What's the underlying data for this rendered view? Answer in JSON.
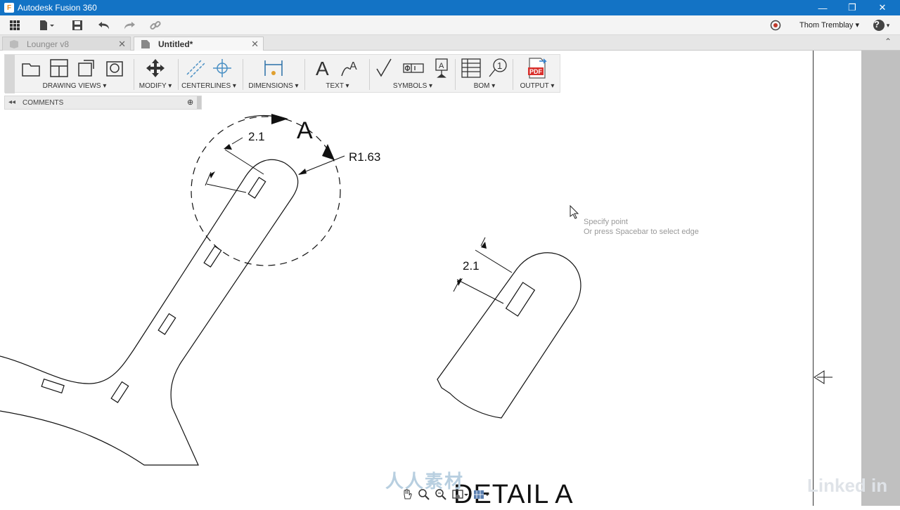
{
  "app": {
    "title": "Autodesk Fusion 360",
    "logo_letter": "F"
  },
  "window_controls": {
    "minimize": "—",
    "restore": "❐",
    "close": "✕"
  },
  "user": {
    "name": "Thom Tremblay ▾",
    "help": "?"
  },
  "tabs": [
    {
      "label": "Lounger v8",
      "close": "✕"
    },
    {
      "label": "Untitled*",
      "close": "✕"
    }
  ],
  "toolbar": {
    "groups": [
      "DRAWING VIEWS ▾",
      "MODIFY ▾",
      "CENTERLINES ▾",
      "DIMENSIONS ▾",
      "TEXT ▾",
      "SYMBOLS ▾",
      "BOM ▾",
      "OUTPUT ▾"
    ],
    "pdf_label": "PDF"
  },
  "comments": {
    "label": "COMMENTS"
  },
  "drawing": {
    "dim_left": "2.1",
    "detail_label": "A",
    "radius": "R1.63",
    "dim_detail": "2.1",
    "detail_title": "DETAIL A",
    "bom_balloon": "1"
  },
  "hint": {
    "line1": "Specify point",
    "line2": "Or press Spacebar to select edge"
  },
  "watermark": {
    "brand": "Linked in",
    "site": "人人素材"
  }
}
